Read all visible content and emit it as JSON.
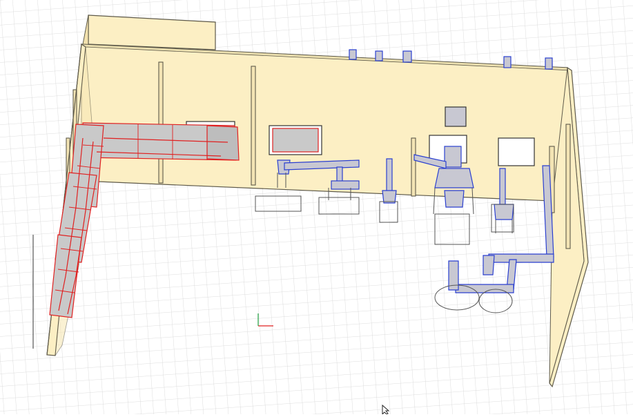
{
  "colors": {
    "background": "#ffffff",
    "grid": "#d4d4d4",
    "wall": "#fcefc4",
    "wall_edge": "#5e5a4a",
    "red_duct": "#e02020",
    "red_duct_fill": "#c9c9c9",
    "blue_duct": "#2a3fd0",
    "blue_duct_fill": "#c8c8d2",
    "axis_red": "#e02020",
    "axis_green": "#20a040"
  },
  "icons": {
    "cursor": "mouse-pointer-icon",
    "axes": "xyz-axes-icon"
  }
}
